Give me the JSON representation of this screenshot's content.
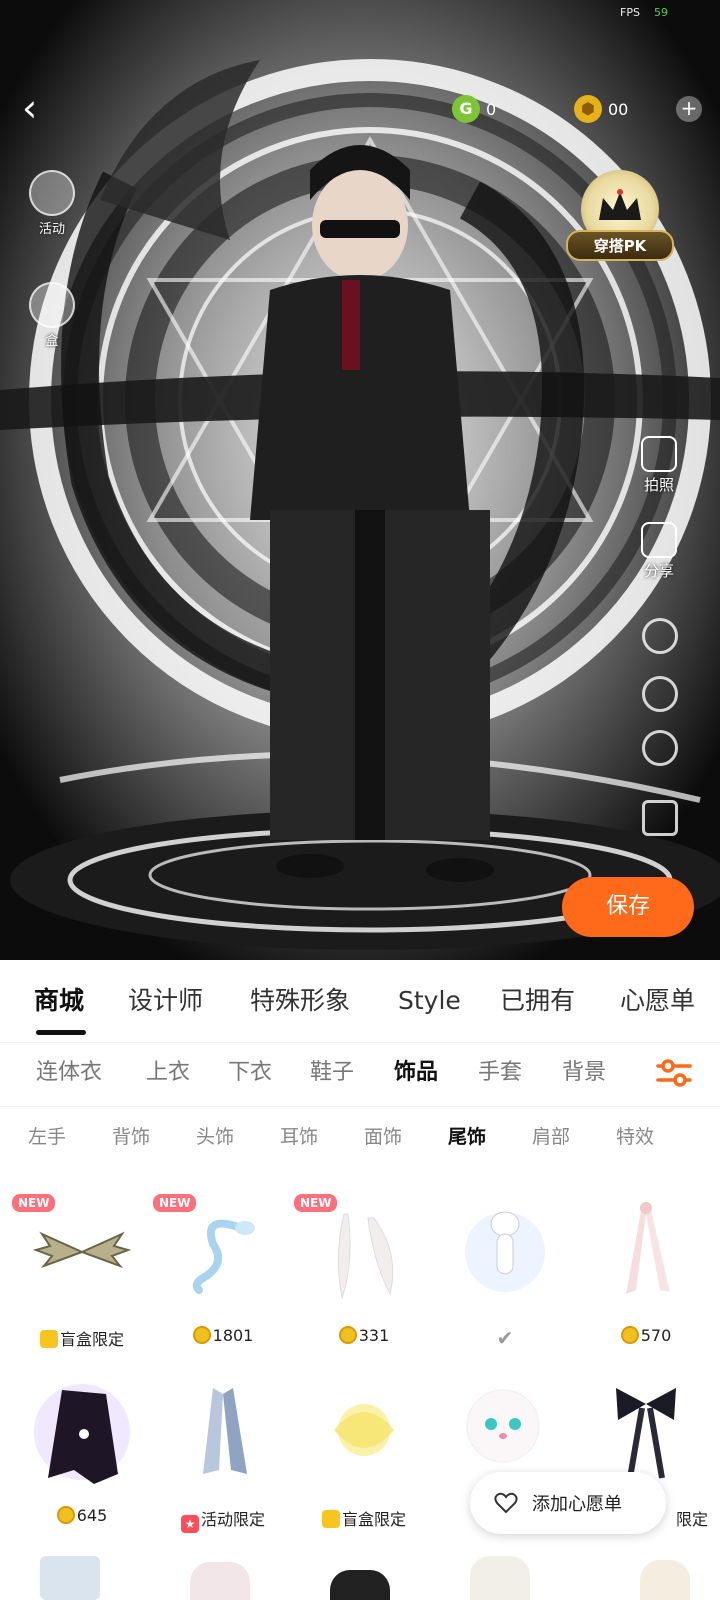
{
  "status": {
    "fps_label": "FPS",
    "fps_value": "59"
  },
  "header": {
    "currency_g": {
      "symbol": "G",
      "value": "0"
    },
    "currency_coin": {
      "value": "00"
    }
  },
  "left_side": [
    {
      "label": "活动",
      "icon": "lantern-icon"
    },
    {
      "label": "盒",
      "icon": "blind-box-icon"
    }
  ],
  "pk_badge": {
    "label": "穿搭PK",
    "icon": "crown-icon"
  },
  "right_side": [
    {
      "label": "拍照",
      "icon": "camera-icon"
    },
    {
      "label": "分享",
      "icon": "share-icon"
    }
  ],
  "save_button": "保存",
  "main_tabs": [
    "商城",
    "设计师",
    "特殊形象",
    "Style",
    "已拥有",
    "心愿单"
  ],
  "category_tabs": [
    "连体衣",
    "上衣",
    "下衣",
    "鞋子",
    "饰品",
    "手套",
    "背景"
  ],
  "sub_tabs": [
    "左手",
    "背饰",
    "头饰",
    "耳饰",
    "面饰",
    "尾饰",
    "肩部",
    "特效"
  ],
  "items": [
    {
      "new": "NEW",
      "price_type": "box",
      "price": "盲盒限定",
      "art": "bat-wings"
    },
    {
      "new": "NEW",
      "price_type": "coin",
      "price": "1801",
      "art": "blue-serpent"
    },
    {
      "new": "NEW",
      "price_type": "coin",
      "price": "331",
      "art": "white-feathers"
    },
    {
      "new": "",
      "price_type": "owned",
      "price": "✔",
      "art": "cat-pendant"
    },
    {
      "new": "",
      "price_type": "coin",
      "price": "570",
      "art": "pink-ribbons"
    },
    {
      "new": "",
      "price_type": "coin",
      "price": "645",
      "art": "dark-cape"
    },
    {
      "new": "",
      "price_type": "star",
      "price": "活动限定",
      "art": "blue-ribbons"
    },
    {
      "new": "",
      "price_type": "box",
      "price": "盲盒限定",
      "art": "yellow-flower"
    },
    {
      "new": "",
      "price_type": "none",
      "price": "",
      "art": "white-cat"
    },
    {
      "new": "",
      "price_type": "text",
      "price": "限定",
      "art": "black-bow"
    }
  ],
  "wishlist_button": "添加心愿单",
  "colors": {
    "accent": "#ff6a1a",
    "new_badge": "#ff6f7b",
    "coin": "#f0c020",
    "g_coin": "#7cc534"
  }
}
